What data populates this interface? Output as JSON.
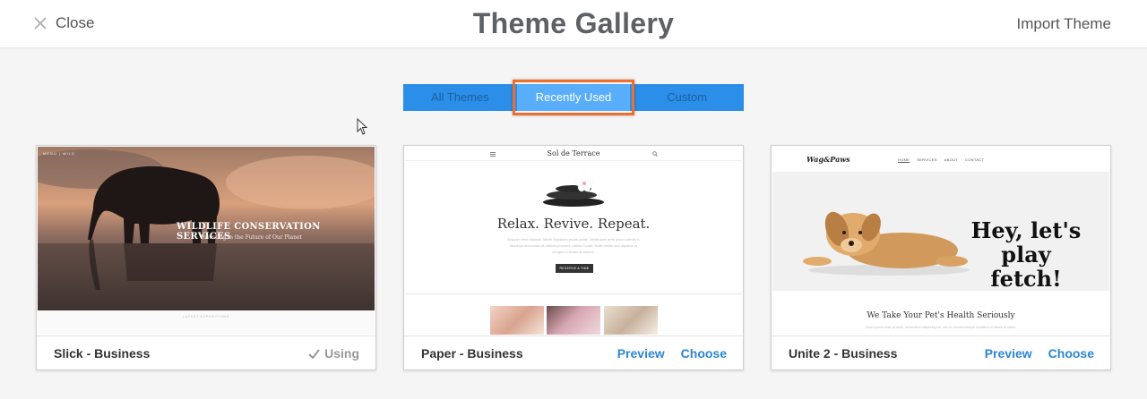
{
  "header": {
    "close_label": "Close",
    "title": "Theme Gallery",
    "import_label": "Import Theme"
  },
  "tabs": [
    {
      "label": "All Themes",
      "active": false
    },
    {
      "label": "Recently Used",
      "active": true
    },
    {
      "label": "Custom",
      "active": false
    }
  ],
  "themes": [
    {
      "name": "Slick - Business",
      "status": "Using",
      "preview": {
        "nav": "MENU   |   WILD",
        "headline": "WILDLIFE CONSERVATION SERVICES",
        "subline": "Investing in the Future of Our Planet",
        "footer_text": "LATEST EXPEDITIONS"
      }
    },
    {
      "name": "Paper - Business",
      "preview_label": "Preview",
      "choose_label": "Choose",
      "preview": {
        "brand": "Sol de Terrace",
        "tagline": "Relax. Revive. Repeat.",
        "body": "Aliquam erat volutpat. Morbi dignissim purus porta. Vestibulum ante ipsum primis in faucibus orci luctus et ultrices posuere cubilia Curae; Nulla mollis sed dapibus et congue id lectus at mauris.",
        "button": "RESERVE A TIME"
      }
    },
    {
      "name": "Unite 2 - Business",
      "preview_label": "Preview",
      "choose_label": "Choose",
      "preview": {
        "brand": "Wag&Paws",
        "menu": [
          "HOME",
          "SERVICES",
          "ABOUT",
          "CONTACT"
        ],
        "headline": "Hey, let's play fetch!",
        "subline": "We Take Your Pet's Health Seriously",
        "small": "Lorem ipsum dolor sit amet, consectetur adipiscing elit, sed do eiusmod tempor incididunt ut labore et dolore."
      }
    }
  ],
  "colors": {
    "tab_bar": "#2b8ee8",
    "tab_active": "#59aefc",
    "highlight": "#ee6f2d",
    "link": "#2b86d6"
  }
}
